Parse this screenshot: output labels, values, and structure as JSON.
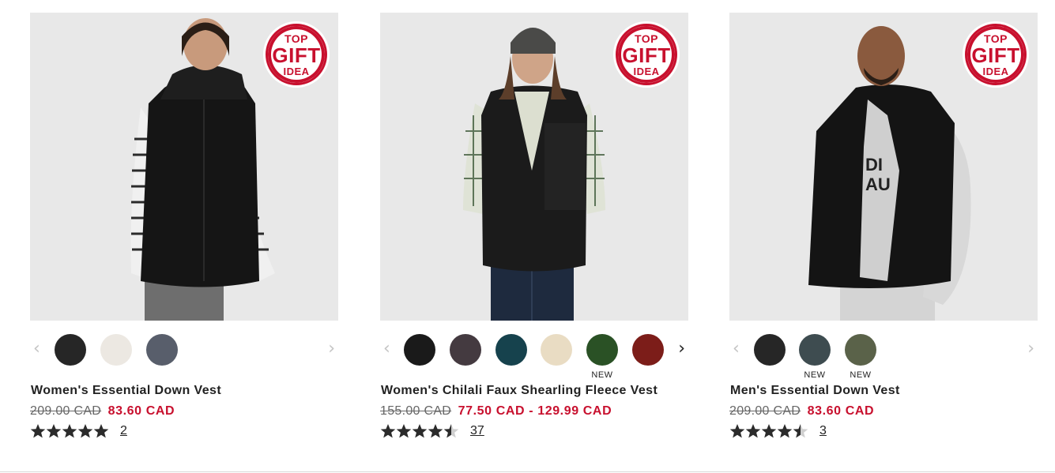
{
  "products": [
    {
      "badge": {
        "top": "TOP",
        "gift": "GIFT",
        "idea": "IDEA"
      },
      "name": "Women's Essential Down Vest",
      "price_old": "209.00 CAD",
      "price_new": "83.60 CAD",
      "rating": 5,
      "review_count": "2",
      "swatches": [
        {
          "color": "#262626",
          "new": ""
        },
        {
          "color": "#ece8e2",
          "new": ""
        },
        {
          "color": "#585e6b",
          "new": ""
        }
      ],
      "arrow_left_icon": "chevron-left-icon",
      "arrow_right_icon": "chevron-right-icon"
    },
    {
      "badge": {
        "top": "TOP",
        "gift": "GIFT",
        "idea": "IDEA"
      },
      "name": "Women's Chilali Faux Shearling Fleece Vest",
      "price_old": "155.00 CAD",
      "price_new": "77.50 CAD - 129.99 CAD",
      "rating": 4.5,
      "review_count": "37",
      "swatches": [
        {
          "color": "#1a1a1a",
          "new": ""
        },
        {
          "color": "#443a40",
          "new": ""
        },
        {
          "color": "#16424d",
          "new": ""
        },
        {
          "color": "#e9dcc3",
          "new": ""
        },
        {
          "color": "#2a5125",
          "new": "NEW"
        },
        {
          "color": "#7c1d19",
          "new": ""
        }
      ],
      "arrow_left_icon": "chevron-left-icon",
      "arrow_right_icon": "chevron-right-icon"
    },
    {
      "badge": {
        "top": "TOP",
        "gift": "GIFT",
        "idea": "IDEA"
      },
      "name": "Men's Essential Down Vest",
      "price_old": "209.00 CAD",
      "price_new": "83.60 CAD",
      "rating": 4.5,
      "review_count": "3",
      "swatches": [
        {
          "color": "#262626",
          "new": ""
        },
        {
          "color": "#3e4c50",
          "new": "NEW"
        },
        {
          "color": "#5a6249",
          "new": "NEW"
        }
      ],
      "arrow_left_icon": "chevron-left-icon",
      "arrow_right_icon": "chevron-right-icon"
    }
  ],
  "colors": {
    "sale_red": "#c8102e",
    "image_bg": "#e8e8e8",
    "star": "#2b2b2b"
  }
}
